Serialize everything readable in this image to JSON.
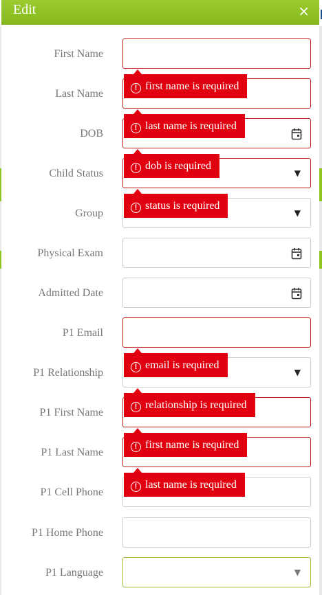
{
  "dialog": {
    "title": "Edit",
    "close_glyph": "×"
  },
  "colors": {
    "titlebar": "#8fc31f",
    "error_border": "#c41c1c",
    "tooltip_bg": "#e0000f"
  },
  "fields": [
    {
      "label": "First Name",
      "kind": "text",
      "error": "first name is required"
    },
    {
      "label": "Last Name",
      "kind": "text",
      "error": "last name is required"
    },
    {
      "label": "DOB",
      "kind": "date",
      "icon": "calendar-icon",
      "error": "dob is required"
    },
    {
      "label": "Child Status",
      "kind": "select",
      "error": "status is required"
    },
    {
      "label": "Group",
      "kind": "select"
    },
    {
      "label": "Physical Exam",
      "kind": "date",
      "icon": "calendar-icon"
    },
    {
      "label": "Admitted Date",
      "kind": "date",
      "icon": "calendar-icon"
    },
    {
      "label": "P1 Email",
      "kind": "text",
      "error": "email is required"
    },
    {
      "label": "P1 Relationship",
      "kind": "select",
      "error": "relationship is required"
    },
    {
      "label": "P1 First Name",
      "kind": "text",
      "error": "first name is required"
    },
    {
      "label": "P1 Last Name",
      "kind": "text",
      "error": "last name is required"
    },
    {
      "label": "P1 Cell Phone",
      "kind": "text"
    },
    {
      "label": "P1 Home Phone",
      "kind": "text"
    },
    {
      "label": "P1 Language",
      "kind": "select"
    }
  ]
}
